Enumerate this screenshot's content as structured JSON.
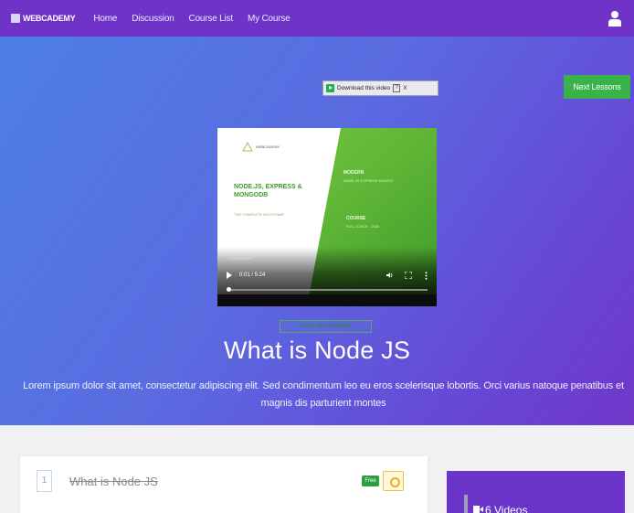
{
  "navbar": {
    "brand": "WEBCADEMY",
    "links": [
      "Home",
      "Discussion",
      "Course List",
      "My Course"
    ],
    "user_icon": "user-icon"
  },
  "video_overlay": {
    "download_label": "Download this video",
    "help": "?",
    "close": "X"
  },
  "next_button": "Next Lessons",
  "video": {
    "logo_text": "WEBCADEMY",
    "title": "NODE.JS, EXPRESS & MONGODB",
    "subtitle": "THE COMPLETE BOOTCAMP",
    "right_heading_1": "MODERN",
    "right_line_1": "NODE JS  EXPRESS  MONGO",
    "right_heading_2": "COURSE",
    "right_line_2": "FULL STACK · 2020",
    "channel": "WEBCADEMY",
    "time": "0:01 / 5:24",
    "progress": 0.01
  },
  "mark_complete": "Mark as complete",
  "lesson": {
    "title": "What is Node JS",
    "description": "Lorem ipsum dolor sit amet, consectetur adipiscing elit. Sed condimentum leo eu eros scelerisque lobortis. Orci varius natoque penatibus et magnis dis parturient montes"
  },
  "lesson_list": {
    "number": "1",
    "item_title": "What is Node JS",
    "badge": "Free"
  },
  "sidebar": {
    "video_count": "6 Videos"
  },
  "colors": {
    "nav": "#6f33c8",
    "hero_start": "#4d7fe8",
    "hero_end": "#7137c9",
    "next_button": "#38b34a",
    "free_badge": "#2e9e43",
    "side_card": "#6a35c8"
  }
}
